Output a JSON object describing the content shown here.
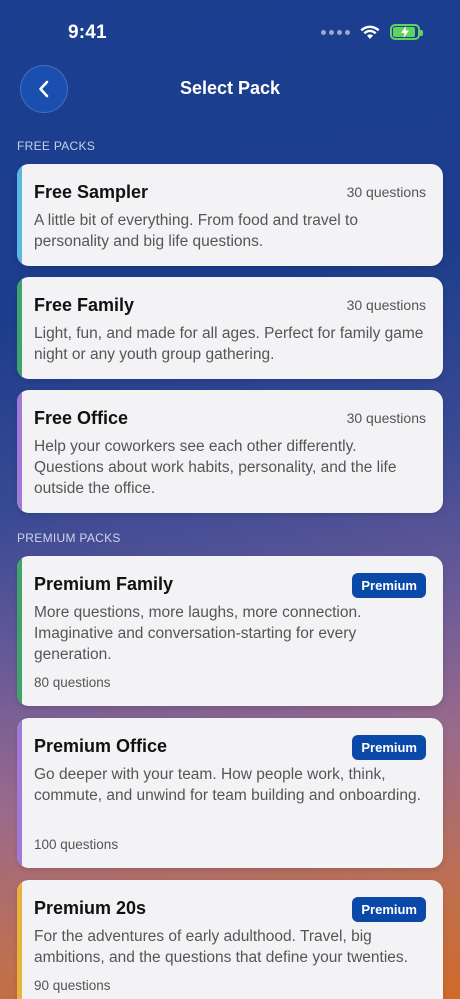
{
  "status_bar": {
    "time": "9:41"
  },
  "nav": {
    "title": "Select Pack"
  },
  "sections": {
    "free_label": "FREE PACKS",
    "premium_label": "PREMIUM PACKS"
  },
  "colors": {
    "accent_sky": "#5bb6e3",
    "accent_green": "#3fa36b",
    "accent_purple": "#a07ad6",
    "accent_yellow": "#e9b23a",
    "badge": "#0b49a8"
  },
  "free_packs": [
    {
      "title": "Free Sampler",
      "count": "30 questions",
      "description": "A little bit of everything. From food and travel to personality and big life questions."
    },
    {
      "title": "Free Family",
      "count": "30 questions",
      "description": "Light, fun, and made for all ages. Perfect for family game night or any youth group gathering."
    },
    {
      "title": "Free Office",
      "count": "30 questions",
      "description": "Help your coworkers see each other differently. Questions about work habits, personality, and the life outside the office."
    }
  ],
  "premium_packs": [
    {
      "title": "Premium Family",
      "badge": "Premium",
      "description": "More questions, more laughs, more connection. Imaginative and conversation-starting for every generation.",
      "count": "80 questions"
    },
    {
      "title": "Premium Office",
      "badge": "Premium",
      "description": "Go deeper with your team. How people work, think, commute, and unwind for team building and onboarding.",
      "count": "100 questions"
    },
    {
      "title": "Premium 20s",
      "badge": "Premium",
      "description": "For the adventures of early adulthood. Travel, big ambitions, and the questions that define your twenties.",
      "count": "90 questions"
    }
  ]
}
